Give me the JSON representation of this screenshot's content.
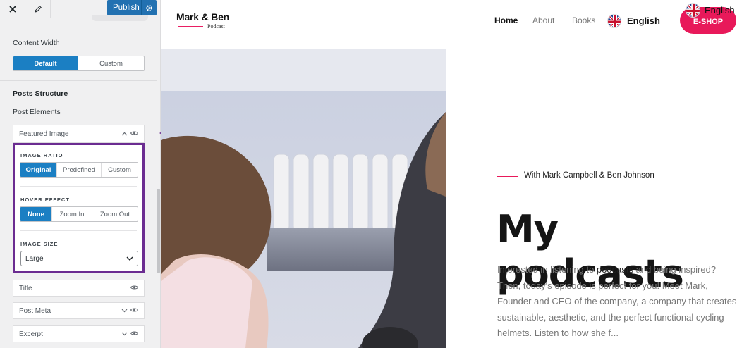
{
  "customizer": {
    "publish_label": "Publish",
    "content_width": {
      "label": "Content Width",
      "options": [
        "Default",
        "Custom"
      ],
      "selected": "Default"
    },
    "posts_structure_heading": "Posts Structure",
    "post_elements_label": "Post Elements",
    "featured_image": {
      "label": "Featured Image",
      "image_ratio": {
        "label": "IMAGE RATIO",
        "options": [
          "Original",
          "Predefined",
          "Custom"
        ],
        "selected": "Original"
      },
      "hover_effect": {
        "label": "HOVER EFFECT",
        "options": [
          "None",
          "Zoom In",
          "Zoom Out"
        ],
        "selected": "None"
      },
      "image_size": {
        "label": "IMAGE SIZE",
        "value": "Large"
      }
    },
    "elements": [
      {
        "label": "Title"
      },
      {
        "label": "Post Meta"
      },
      {
        "label": "Excerpt"
      }
    ]
  },
  "site": {
    "logo_main": "Mark & Ben",
    "logo_sub": "Podcast",
    "nav": [
      "Home",
      "About",
      "Books"
    ],
    "language": "English",
    "language_top": "English",
    "eshop_label": "E-SHOP",
    "tagline": "With Mark Campbell & Ben Johnson",
    "heading": "My podcasts",
    "body_parts": [
      "Interested in listening to ",
      "podcasts",
      " and being inspired? Then, today's episode is perfect for you! Meet Mark, Founder and CEO of the company, a company that creates sustainable, aesthetic, and the perfect functional cycling helmets. Listen to how she f..."
    ]
  },
  "colors": {
    "accent_blue": "#1b7fc3",
    "highlight_border": "#6b2c91",
    "brand_pink": "#e8195a"
  }
}
